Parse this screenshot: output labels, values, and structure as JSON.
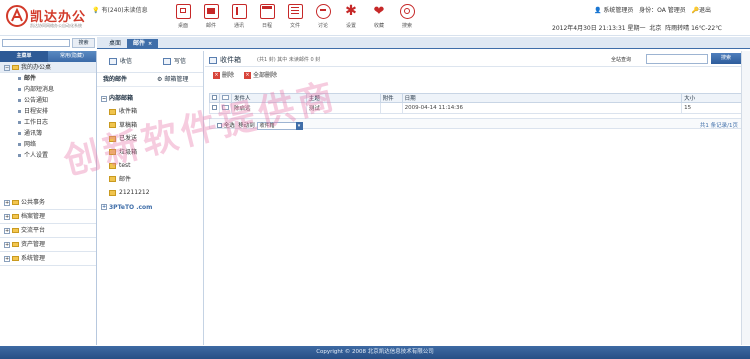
{
  "header": {
    "logo_title": "凯达办公",
    "logo_subtitle": "凯达协同网络办公自动化系统",
    "message": "有(240)未读信息",
    "user_name": "系统管理员",
    "role": "身份：OA 管理员",
    "logout": "退出",
    "datetime": "2012年4月30日 21:13:31 星期一",
    "city": "北京",
    "weather": "阵雨转晴 16℃-22℃"
  },
  "toolbar": [
    {
      "label": "桌面",
      "icon": "desktop-icon"
    },
    {
      "label": "邮件",
      "icon": "mail-icon"
    },
    {
      "label": "通讯",
      "icon": "address-book-icon"
    },
    {
      "label": "日程",
      "icon": "calendar-icon"
    },
    {
      "label": "文件",
      "icon": "file-icon"
    },
    {
      "label": "讨论",
      "icon": "chat-icon"
    },
    {
      "label": "设置",
      "icon": "gear-icon"
    },
    {
      "label": "收藏",
      "icon": "heart-icon"
    },
    {
      "label": "搜索",
      "icon": "search-icon"
    }
  ],
  "search": {
    "button": "搜索"
  },
  "sidebar": {
    "tabs": [
      "主菜单",
      "常用(隐藏)"
    ],
    "groups": [
      {
        "label": "我的办公桌",
        "open": true
      }
    ],
    "items": [
      "邮件",
      "内部短消息",
      "公告通知",
      "日程安排",
      "工作日志",
      "通讯簿",
      "网络",
      "个人设置"
    ],
    "bottom_groups": [
      "公共事务",
      "档案管理",
      "交流平台",
      "资产管理",
      "系统管理"
    ]
  },
  "tabs": [
    {
      "label": "桌面",
      "active": false
    },
    {
      "label": "邮件",
      "active": true
    }
  ],
  "mailcol": {
    "receive": "收信",
    "compose": "写信",
    "mymail": "我的邮件",
    "manage": "邮箱管理",
    "root": "内部邮箱",
    "folders": [
      "收件箱",
      "草稿箱",
      "已发送",
      "垃圾箱",
      "test",
      "邮件",
      "21211212"
    ],
    "external": "3PTeTO .com"
  },
  "main": {
    "title": "收件箱",
    "count_text": "(共1 封) 其中 未读邮件 0 封",
    "query_label": "全站查询",
    "query_button": "搜索",
    "delete": "删除",
    "delete_all": "全部删除",
    "columns": [
      "",
      "",
      "发件人",
      "主题",
      "附件",
      "日期",
      "大小"
    ],
    "rows": [
      {
        "sender": "陈启远",
        "subject": "测试",
        "attachment": "",
        "date": "2009-04-14 11:14:36",
        "size": "15"
      }
    ],
    "footer_select_all": "全选",
    "footer_move": "移动到",
    "footer_target": "收件箱",
    "footer_total": "共1 条记录/1页"
  },
  "watermark": "创新软件提供商",
  "footer": "Copyright © 2008 北京凯达信息技术有限公司"
}
